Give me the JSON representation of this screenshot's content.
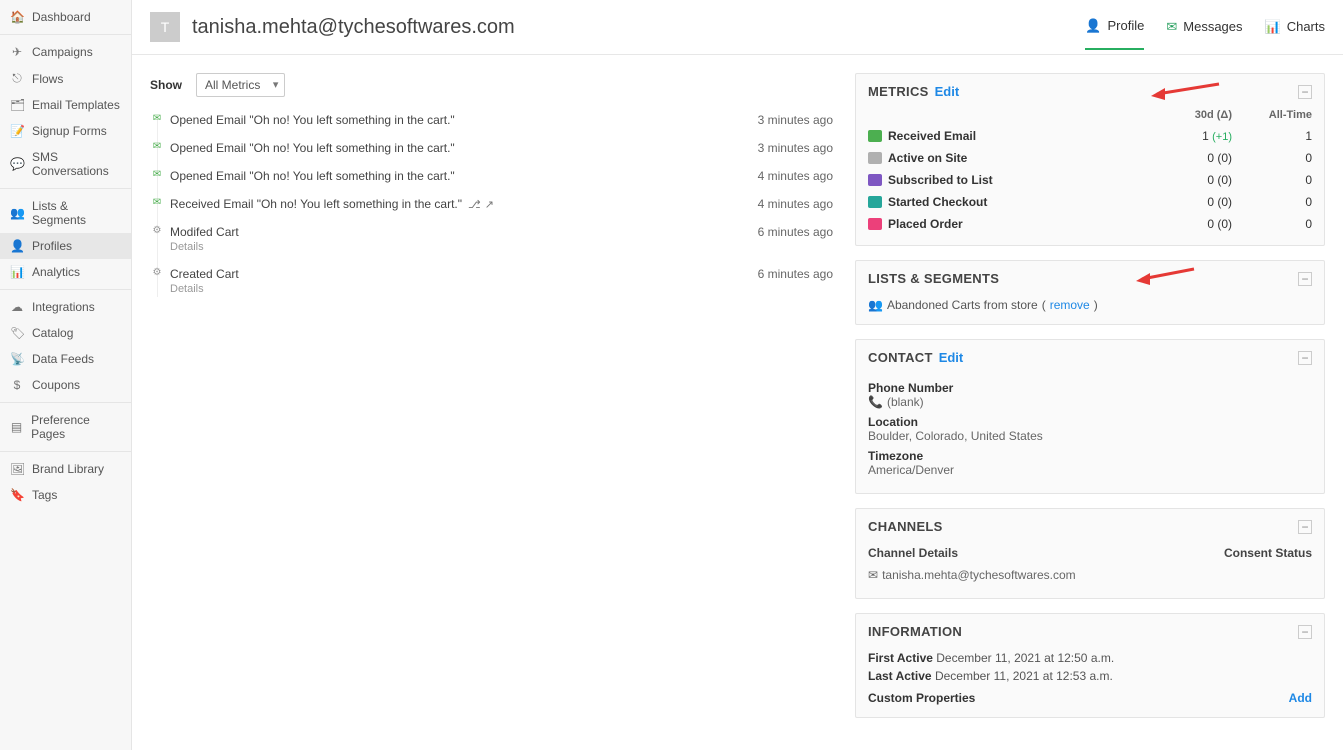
{
  "sidebar": {
    "groups": [
      [
        {
          "icon": "🏠",
          "label": "Dashboard"
        }
      ],
      [
        {
          "icon": "✈",
          "label": "Campaigns"
        },
        {
          "icon": "⎋",
          "label": "Flows"
        },
        {
          "icon": "🗂",
          "label": "Email Templates"
        },
        {
          "icon": "📝",
          "label": "Signup Forms"
        },
        {
          "icon": "💬",
          "label": "SMS Conversations"
        }
      ],
      [
        {
          "icon": "👥",
          "label": "Lists & Segments"
        },
        {
          "icon": "👤",
          "label": "Profiles",
          "active": true
        },
        {
          "icon": "📊",
          "label": "Analytics"
        }
      ],
      [
        {
          "icon": "☁",
          "label": "Integrations"
        },
        {
          "icon": "🏷",
          "label": "Catalog"
        },
        {
          "icon": "📡",
          "label": "Data Feeds"
        },
        {
          "icon": "$",
          "label": "Coupons"
        }
      ],
      [
        {
          "icon": "▤",
          "label": "Preference Pages"
        }
      ],
      [
        {
          "icon": "🖼",
          "label": "Brand Library"
        },
        {
          "icon": "🔖",
          "label": "Tags"
        }
      ]
    ]
  },
  "header": {
    "avatar_letter": "T",
    "email": "tanisha.mehta@tychesoftwares.com",
    "tabs": [
      {
        "icon": "👤",
        "label": "Profile",
        "active": true
      },
      {
        "icon": "✉",
        "label": "Messages"
      },
      {
        "icon": "📊",
        "label": "Charts"
      }
    ]
  },
  "activity": {
    "show_label": "Show",
    "select_value": "All Metrics",
    "events": [
      {
        "bullet_color": "#4caf50",
        "bullet": "✉",
        "title": "Opened Email \"Oh no! You left something in the cart.\"",
        "time": "3 minutes ago"
      },
      {
        "bullet_color": "#4caf50",
        "bullet": "✉",
        "title": "Opened Email \"Oh no! You left something in the cart.\"",
        "time": "3 minutes ago"
      },
      {
        "bullet_color": "#4caf50",
        "bullet": "✉",
        "title": "Opened Email \"Oh no! You left something in the cart.\"",
        "time": "4 minutes ago"
      },
      {
        "bullet_color": "#4caf50",
        "bullet": "✉",
        "title": "Received Email \"Oh no! You left something in the cart.\"",
        "time": "4 minutes ago",
        "extra_icons": true
      },
      {
        "bullet_color": "#999",
        "bullet": "⚙",
        "title": "Modifed Cart",
        "details": "Details",
        "time": "6 minutes ago"
      },
      {
        "bullet_color": "#999",
        "bullet": "⚙",
        "title": "Created Cart",
        "details": "Details",
        "time": "6 minutes ago"
      }
    ]
  },
  "metrics": {
    "title": "METRICS",
    "edit": "Edit",
    "col30": "30d (Δ)",
    "colAll": "All-Time",
    "rows": [
      {
        "badge": "green",
        "name": "Received Email",
        "v30": "1",
        "delta": "(+1)",
        "all": "1"
      },
      {
        "badge": "gray",
        "name": "Active on Site",
        "v30": "0",
        "delta": "(0)",
        "all": "0"
      },
      {
        "badge": "purple",
        "name": "Subscribed to List",
        "v30": "0",
        "delta": "(0)",
        "all": "0"
      },
      {
        "badge": "teal",
        "name": "Started Checkout",
        "v30": "0",
        "delta": "(0)",
        "all": "0"
      },
      {
        "badge": "pink",
        "name": "Placed Order",
        "v30": "0",
        "delta": "(0)",
        "all": "0"
      }
    ]
  },
  "lists": {
    "title": "LISTS & SEGMENTS",
    "item_icon": "👥",
    "item": "Abandoned Carts from store",
    "remove_open": "(",
    "remove": "remove",
    "remove_close": ")"
  },
  "contact": {
    "title": "CONTACT",
    "edit": "Edit",
    "phone_label": "Phone Number",
    "phone_icon": "📞",
    "phone_value": "(blank)",
    "location_label": "Location",
    "location_value": "Boulder, Colorado, United States",
    "tz_label": "Timezone",
    "tz_value": "America/Denver"
  },
  "channels": {
    "title": "CHANNELS",
    "col1": "Channel Details",
    "col2": "Consent Status",
    "email_icon": "✉",
    "email": "tanisha.mehta@tychesoftwares.com"
  },
  "information": {
    "title": "INFORMATION",
    "first_label": "First Active",
    "first_value": "December 11, 2021 at 12:50 a.m.",
    "last_label": "Last Active",
    "last_value": "December 11, 2021 at 12:53 a.m.",
    "custom_label": "Custom Properties",
    "add": "Add"
  }
}
